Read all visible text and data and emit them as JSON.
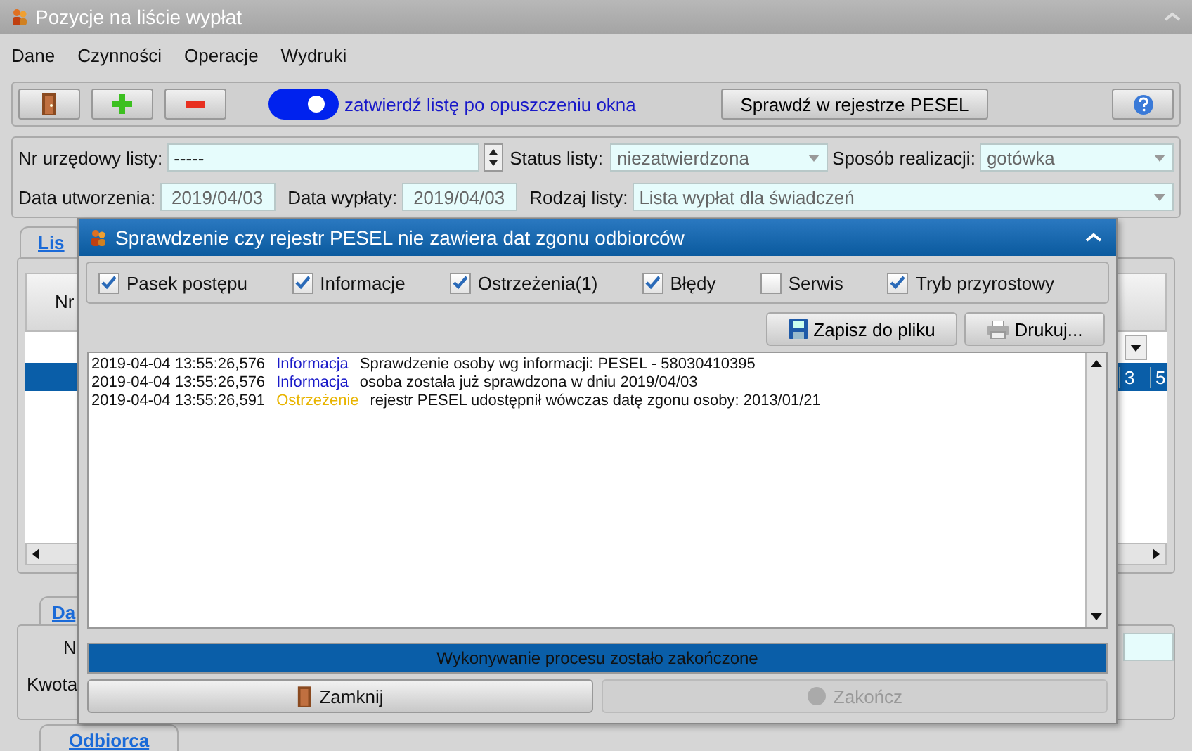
{
  "window": {
    "title": "Pozycje na liście wypłat"
  },
  "menu": [
    "Dane",
    "Czynności",
    "Operacje",
    "Wydruki"
  ],
  "toolbar": {
    "toggle": {
      "on": true,
      "label": "zatwierdź listę po opuszczeniu okna"
    },
    "pesel_button": "Sprawdź w rejestrze PESEL"
  },
  "form": {
    "nr_label": "Nr urzędowy listy:",
    "nr_value": "-----",
    "status_label": "Status listy:",
    "status_value": "niezatwierdzona",
    "sposob_label": "Sposób realizacji:",
    "sposob_value": "gotówka",
    "utw_label": "Data utworzenia:",
    "utw_value": "2019/04/03",
    "wyp_label": "Data wypłaty:",
    "wyp_value": "2019/04/03",
    "rodzaj_label": "Rodzaj listy:",
    "rodzaj_value": "Lista wypłat dla świadczeń"
  },
  "top_tabs": [
    {
      "label": "Lis",
      "selected": true
    }
  ],
  "table": {
    "column_1": "Nr",
    "selected_row": {
      "selected": true,
      "cells": [
        "3",
        "5"
      ]
    }
  },
  "bottom_tabs": [
    {
      "label": "Da",
      "selected": true
    }
  ],
  "detail_labels": [
    "N",
    "Kwota"
  ],
  "lower_tabs": [
    {
      "label": "Odbiorca",
      "selected": true
    }
  ],
  "dialog": {
    "title": "Sprawdzenie czy rejestr PESEL nie zawiera dat zgonu odbiorców",
    "filters": [
      {
        "label": "Pasek postępu",
        "checked": true
      },
      {
        "label": "Informacje",
        "checked": true
      },
      {
        "label": "Ostrzeżenia(1)",
        "checked": true
      },
      {
        "label": "Błędy",
        "checked": true
      },
      {
        "label": "Serwis",
        "checked": false
      },
      {
        "label": "Tryb przyrostowy",
        "checked": true
      }
    ],
    "save_button": "Zapisz do pliku",
    "print_button": "Drukuj...",
    "log": [
      {
        "time": "2019-04-04 13:55:26,576",
        "kind": "info",
        "type": "Informacja",
        "message": "Sprawdzenie osoby wg informacji: PESEL - 58030410395"
      },
      {
        "time": "2019-04-04 13:55:26,576",
        "kind": "info",
        "type": "Informacja",
        "message": "osoba została już sprawdzona w dniu 2019/04/03"
      },
      {
        "time": "2019-04-04 13:55:26,591",
        "kind": "warning",
        "type": "Ostrzeżenie",
        "message": "rejestr PESEL udostępnił wówczas datę zgonu osoby: 2013/01/21"
      }
    ],
    "progress": {
      "level": 1,
      "text": "Wykonywanie procesu zostało zakończone"
    },
    "buttons": [
      {
        "label": "Zamknij",
        "disabled": false
      },
      {
        "label": "Zakończ",
        "disabled": true
      }
    ]
  }
}
